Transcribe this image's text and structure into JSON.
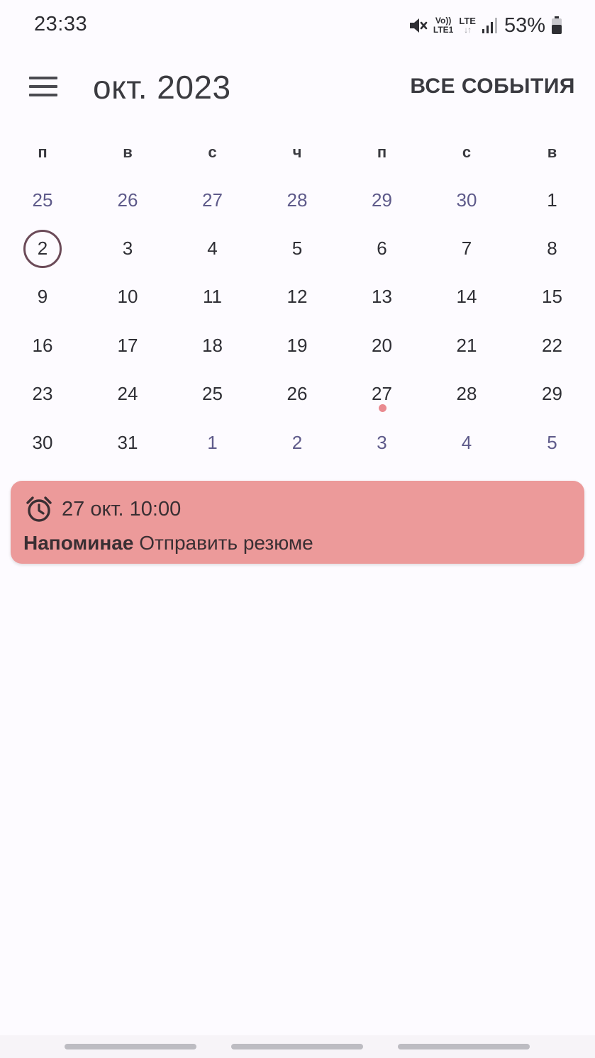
{
  "status_bar": {
    "time": "23:33",
    "volte_top": "Vo))",
    "volte_bottom": "LTE1",
    "lte_label": "LTE",
    "lte_arrows": "↓↑",
    "battery": "53%",
    "icons": [
      "mute-icon",
      "volte-icon",
      "lte-icon",
      "signal-icon",
      "battery-icon"
    ]
  },
  "app_bar": {
    "menu_icon": "hamburger-menu-icon",
    "title": "окт. 2023",
    "all_events": "ВСЕ СОБЫТИЯ"
  },
  "calendar": {
    "weekdays": [
      "п",
      "в",
      "с",
      "ч",
      "п",
      "с",
      "в"
    ],
    "weeks": [
      [
        {
          "day": "25",
          "other": true
        },
        {
          "day": "26",
          "other": true
        },
        {
          "day": "27",
          "other": true
        },
        {
          "day": "28",
          "other": true
        },
        {
          "day": "29",
          "other": true
        },
        {
          "day": "30",
          "other": true
        },
        {
          "day": "1"
        }
      ],
      [
        {
          "day": "2",
          "today": true
        },
        {
          "day": "3"
        },
        {
          "day": "4"
        },
        {
          "day": "5"
        },
        {
          "day": "6"
        },
        {
          "day": "7"
        },
        {
          "day": "8"
        }
      ],
      [
        {
          "day": "9"
        },
        {
          "day": "10"
        },
        {
          "day": "11"
        },
        {
          "day": "12"
        },
        {
          "day": "13"
        },
        {
          "day": "14"
        },
        {
          "day": "15"
        }
      ],
      [
        {
          "day": "16"
        },
        {
          "day": "17"
        },
        {
          "day": "18"
        },
        {
          "day": "19"
        },
        {
          "day": "20"
        },
        {
          "day": "21"
        },
        {
          "day": "22"
        }
      ],
      [
        {
          "day": "23"
        },
        {
          "day": "24"
        },
        {
          "day": "25"
        },
        {
          "day": "26"
        },
        {
          "day": "27",
          "event": true
        },
        {
          "day": "28"
        },
        {
          "day": "29"
        }
      ],
      [
        {
          "day": "30"
        },
        {
          "day": "31"
        },
        {
          "day": "1",
          "other": true
        },
        {
          "day": "2",
          "other": true
        },
        {
          "day": "3",
          "other": true
        },
        {
          "day": "4",
          "other": true
        },
        {
          "day": "5",
          "other": true
        }
      ]
    ]
  },
  "event": {
    "icon": "alarm-clock-icon",
    "datetime": "27 окт. 10:00",
    "label": "Напоминае",
    "title": "Отправить резюме",
    "color": "#ec9a9a"
  },
  "colors": {
    "background": "#fdfbff",
    "other_month_day": "#5e5a8a",
    "today_ring": "#6b4a58",
    "event_dot": "#e98a90"
  }
}
